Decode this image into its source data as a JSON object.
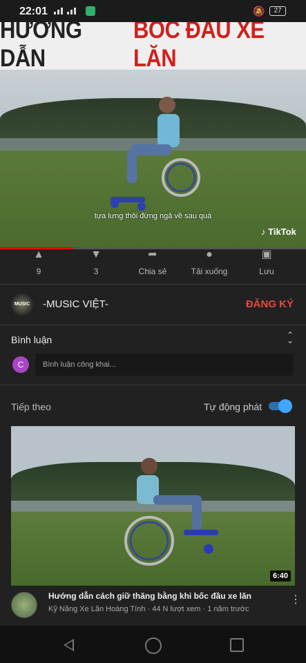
{
  "status": {
    "time": "22:01",
    "battery": "27"
  },
  "video": {
    "title_part1": "HƯỚNG DẪN",
    "title_part2": "BỐC ĐẦU XE LĂN",
    "caption": "tựa lưng thôi đừng ngả về sau quá",
    "watermark": "TikTok",
    "progress": 0.24
  },
  "actions": [
    {
      "icon": "thumbs-up-icon",
      "label": "9"
    },
    {
      "icon": "thumbs-down-icon",
      "label": "3"
    },
    {
      "icon": "share-icon",
      "label": "Chia sẻ"
    },
    {
      "icon": "download-icon",
      "label": "Tải xuống"
    },
    {
      "icon": "save-icon",
      "label": "Lưu"
    }
  ],
  "channel": {
    "name": "-MUSIC VIỆT-",
    "subscribe": "ĐĂNG KÝ",
    "avatar_text": "MUSIC"
  },
  "comments": {
    "header": "Bình luận",
    "user_initial": "C",
    "placeholder": "Bình luận công khai..."
  },
  "up_next": {
    "label": "Tiếp theo",
    "autoplay_label": "Tự động phát",
    "autoplay_on": true
  },
  "next_video": {
    "duration": "6:40",
    "title": "Hướng dẫn cách giữ thăng bằng khi bốc đầu xe lăn",
    "meta": "Kỹ Năng Xe Lăn Hoàng Tính · 44 N lượt xem · 1 năm trước"
  },
  "colors": {
    "accent_red": "#e4493d",
    "toggle_blue": "#3ea6ff",
    "progress_red": "#ee0000"
  }
}
